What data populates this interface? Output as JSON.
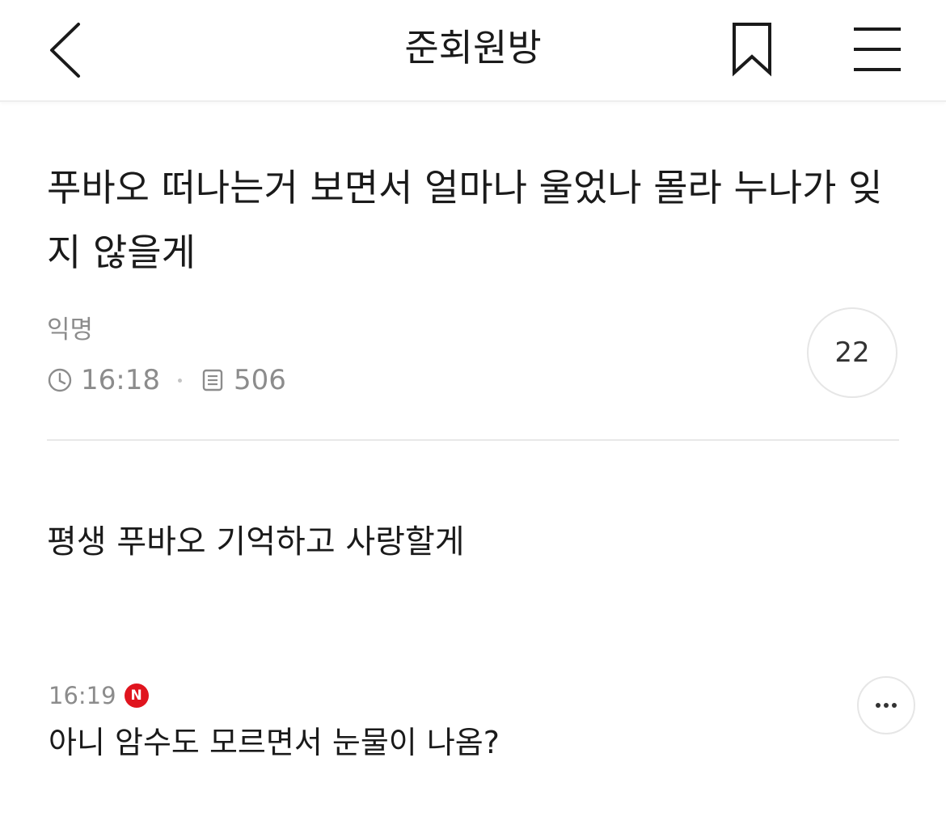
{
  "header": {
    "title": "준회원방",
    "back_icon": "chevron-left-icon",
    "bookmark_icon": "bookmark-icon",
    "menu_icon": "hamburger-menu-icon"
  },
  "post": {
    "title": "푸바오 떠나는거 보면서 얼마나 울었나 몰라 누나가 잊지 않을게",
    "author": "익명",
    "time": "16:18",
    "views": "506",
    "comment_count": "22",
    "body": "평생 푸바오 기억하고 사랑할게"
  },
  "comment": {
    "time": "16:19",
    "badge": "N",
    "badge_color": "#e0141e",
    "text": "아니 암수도 모르면서 눈물이 나옴?",
    "more_icon": "more-options-icon"
  }
}
